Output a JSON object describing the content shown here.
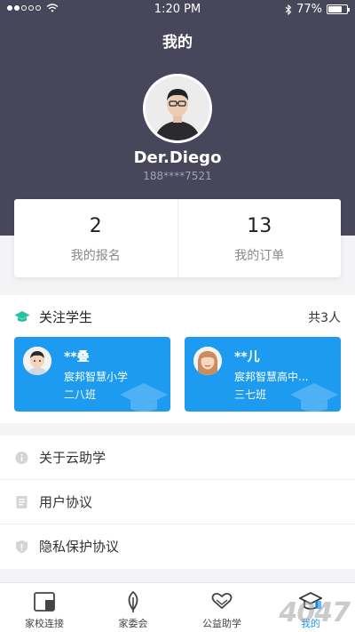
{
  "status_bar": {
    "time": "1:20 PM",
    "battery": "77%",
    "battery_level": 0.77
  },
  "page": {
    "title": "我的"
  },
  "profile": {
    "name": "Der.Diego",
    "phone": "188****7521"
  },
  "stats": [
    {
      "value": "2",
      "label": "我的报名"
    },
    {
      "value": "13",
      "label": "我的订单"
    }
  ],
  "follow": {
    "title": "关注学生",
    "count": "共3人",
    "students": [
      {
        "name": "**叠",
        "school": "宸邦智慧小学",
        "class": "二八班"
      },
      {
        "name": "**儿",
        "school": "宸邦智慧高中...",
        "class": "三七班"
      }
    ]
  },
  "menu": [
    {
      "label": "关于云助学",
      "icon": "info-icon"
    },
    {
      "label": "用户协议",
      "icon": "document-icon"
    },
    {
      "label": "隐私保护协议",
      "icon": "shield-icon"
    }
  ],
  "tabs": [
    {
      "label": "家校连接",
      "icon": "school-link-icon"
    },
    {
      "label": "家委会",
      "icon": "leaf-icon"
    },
    {
      "label": "公益助学",
      "icon": "heart-hands-icon"
    },
    {
      "label": "我的",
      "icon": "graduation-cap-icon",
      "active": true
    }
  ],
  "watermark": "4047",
  "colors": {
    "header": "#47465a",
    "accent": "#1d9bf0",
    "teal": "#25c2a0"
  }
}
